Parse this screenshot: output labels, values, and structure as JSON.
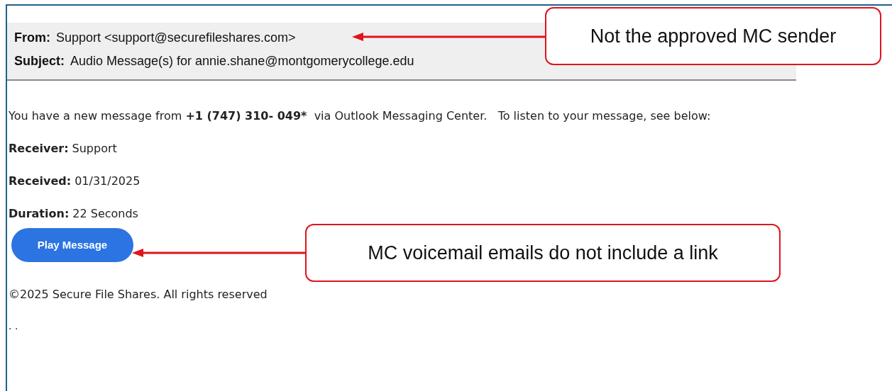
{
  "header": {
    "fields": [
      {
        "label": "From:",
        "value": "Support <support@securefileshares.com>"
      },
      {
        "label": "Subject:",
        "value": "Audio Message(s) for annie.shane@montgomerycollege.edu"
      }
    ]
  },
  "body": {
    "intro": [
      {
        "text": "You have a new message from ",
        "bold": false
      },
      {
        "text": "+1 (747) 310- 049*",
        "bold": true
      },
      {
        "text": "  via Outlook Messaging Center.   To listen to your message, see below:",
        "bold": false
      }
    ],
    "details": [
      {
        "label": "Receiver:",
        "value": "Support"
      },
      {
        "label": "Received:",
        "value": "01/31/2025"
      },
      {
        "label": "Duration:",
        "value": "22 Seconds"
      }
    ],
    "button": "Play Message",
    "footer": "©2025 Secure File Shares. All rights reserved",
    "trailing": ". ."
  },
  "annotations": [
    {
      "text": "Not the approved MC sender",
      "kind": "sender-note"
    },
    {
      "text": "MC voicemail emails do not include a link",
      "kind": "link-note"
    }
  ]
}
